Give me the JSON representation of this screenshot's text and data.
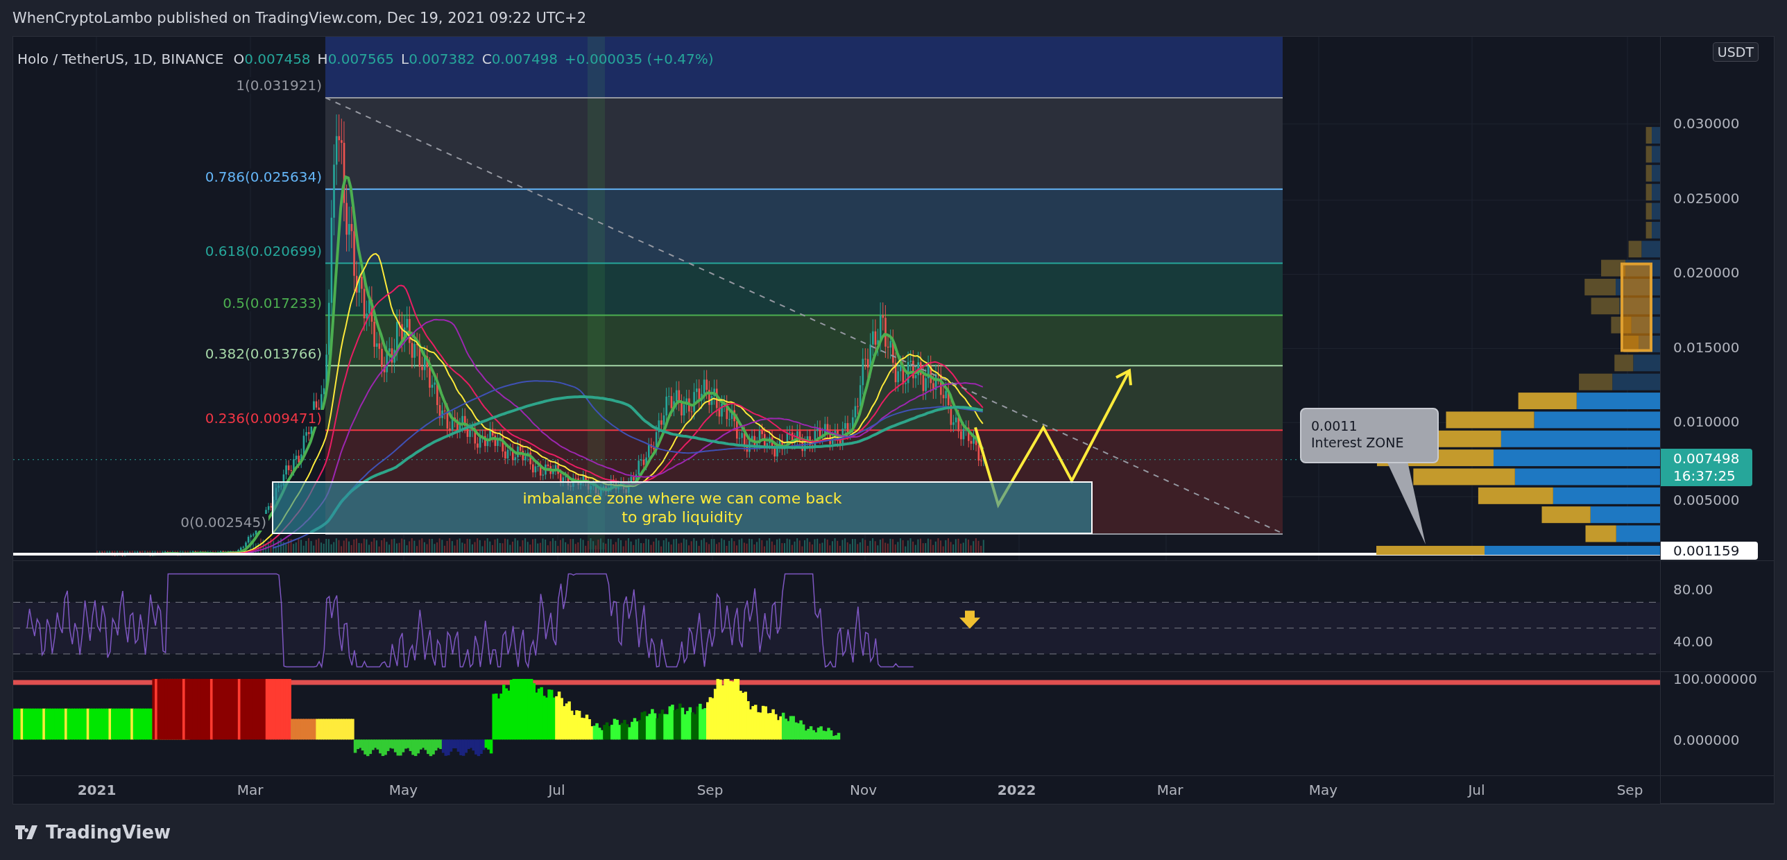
{
  "header": {
    "title": "WhenCryptoLambo published on TradingView.com, Dec 19, 2021 09:22 UTC+2"
  },
  "legend": {
    "symbol": "Holo / TetherUS, 1D, BINANCE",
    "ohlc": [
      {
        "label": "O",
        "value": "0.007458"
      },
      {
        "label": "H",
        "value": "0.007565"
      },
      {
        "label": "L",
        "value": "0.007382"
      },
      {
        "label": "C",
        "value": "0.007498"
      }
    ],
    "change": "+0.000035 (+0.47%)"
  },
  "fib_levels": [
    {
      "label": "1(0.031921)",
      "color": "#9598a1"
    },
    {
      "label": "0.786(0.025634)",
      "color": "#64b5f6"
    },
    {
      "label": "0.618(0.020699)",
      "color": "#26a69a"
    },
    {
      "label": "0.5(0.017233)",
      "color": "#4caf50"
    },
    {
      "label": "0.382(0.013766)",
      "color": "#a5d6a7"
    },
    {
      "label": "0.236(0.009471)",
      "color": "#f23645"
    },
    {
      "label": "0(0.002545)",
      "color": "#9598a1"
    }
  ],
  "annotations": {
    "imbalance": "imbalance zone where we can come back\nto grab liquidity",
    "callout": {
      "value": "0.0011",
      "label": "Interest ZONE"
    }
  },
  "price_axis": {
    "unit": "USDT",
    "ticks": [
      "0.030000",
      "0.025000",
      "0.020000",
      "0.015000",
      "0.010000",
      "0.005000"
    ],
    "last_price": "0.007498",
    "countdown": "16:37:25",
    "level_tag": "0.001159"
  },
  "rsi": {
    "ticks": [
      "80.00",
      "40.00"
    ]
  },
  "oscillator": {
    "ticks": [
      "100.000000",
      "0.000000"
    ]
  },
  "time_axis": {
    "labels": [
      {
        "text": "2021",
        "kind": "year"
      },
      {
        "text": "Mar",
        "kind": "month"
      },
      {
        "text": "May",
        "kind": "month"
      },
      {
        "text": "Jul",
        "kind": "month"
      },
      {
        "text": "Sep",
        "kind": "month"
      },
      {
        "text": "Nov",
        "kind": "month"
      },
      {
        "text": "2022",
        "kind": "year"
      },
      {
        "text": "Mar",
        "kind": "month"
      },
      {
        "text": "May",
        "kind": "month"
      },
      {
        "text": "Jul",
        "kind": "month"
      },
      {
        "text": "Sep",
        "kind": "month"
      }
    ]
  },
  "footer": {
    "logo_text": "TradingView"
  }
}
